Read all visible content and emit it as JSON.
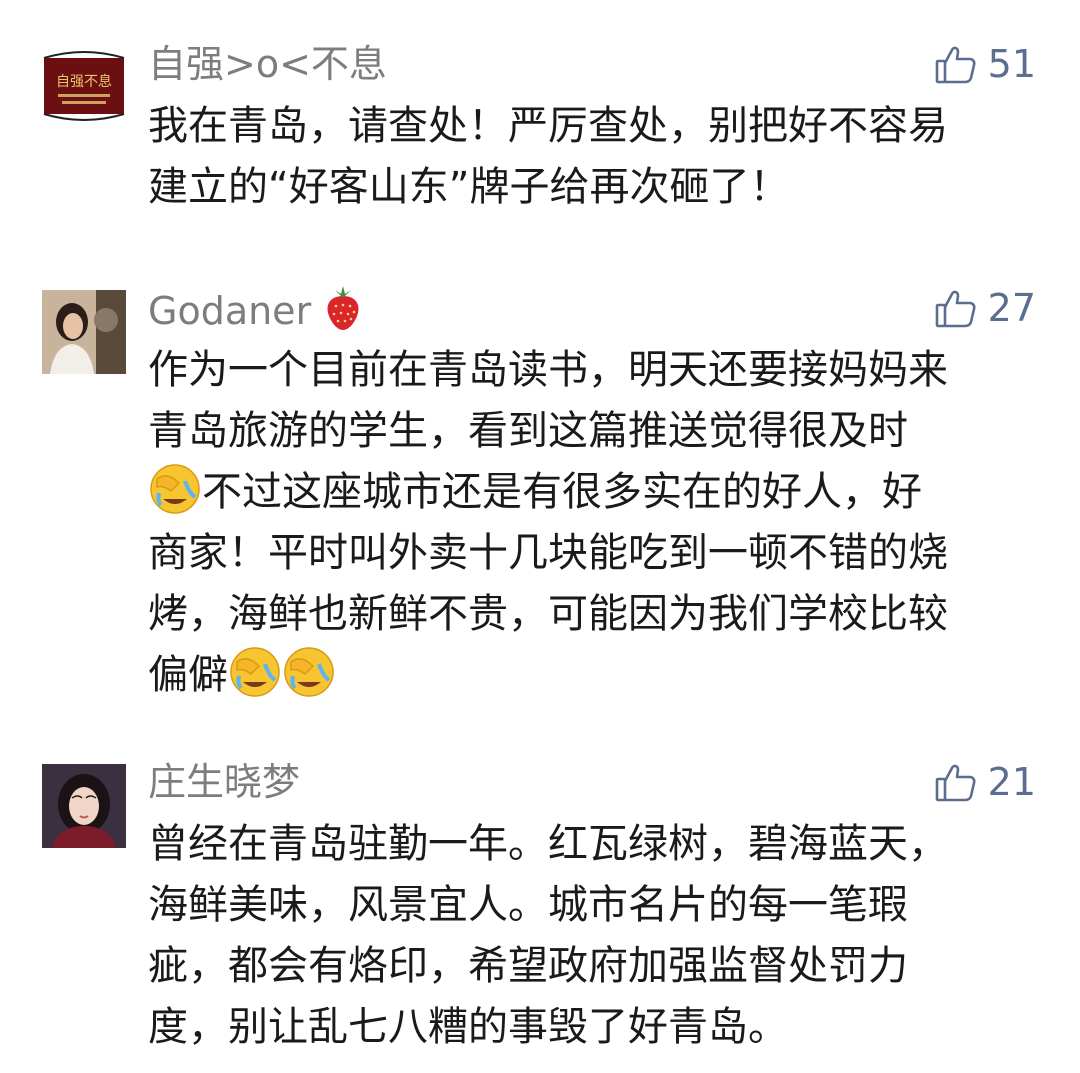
{
  "comments": [
    {
      "username": "自强>o<不息",
      "likes": "51",
      "avatar": {
        "label": "自强不息",
        "icon": "calligraphy-avatar"
      },
      "lines": [
        "我在青岛，请查处！严厉查处，别把好不容易",
        "建立的“好客山东”牌子给再次砸了！"
      ]
    },
    {
      "username": "Godaner",
      "username_emoji": "strawberry-icon",
      "likes": "27",
      "avatar": {
        "icon": "girl-photo-avatar"
      },
      "lines": [
        "作为一个目前在青岛读书，明天还要接妈妈来",
        "青岛旅游的学生，看到这篇推送觉得很及时",
        "不过这座城市还是有很多实在的好人，好",
        "商家！平时叫外卖十几块能吃到一顿不错的烧",
        "烤，海鲜也新鲜不贵，可能因为我们学校比较",
        "偏僻"
      ]
    },
    {
      "username": "庄生晓梦",
      "likes": "21",
      "avatar": {
        "icon": "woman-photo-avatar"
      },
      "lines": [
        "曾经在青岛驻勤一年。红瓦绿树，碧海蓝天，",
        "海鲜美味，风景宜人。城市名片的每一笔瑕",
        "疵，都会有烙印，希望政府加强监督处罚力",
        "度，别让乱七八糟的事毁了好青岛。"
      ]
    }
  ],
  "colors": {
    "username": "#7d7d7d",
    "likes": "#5b6e90",
    "text": "#1a1a1a"
  }
}
